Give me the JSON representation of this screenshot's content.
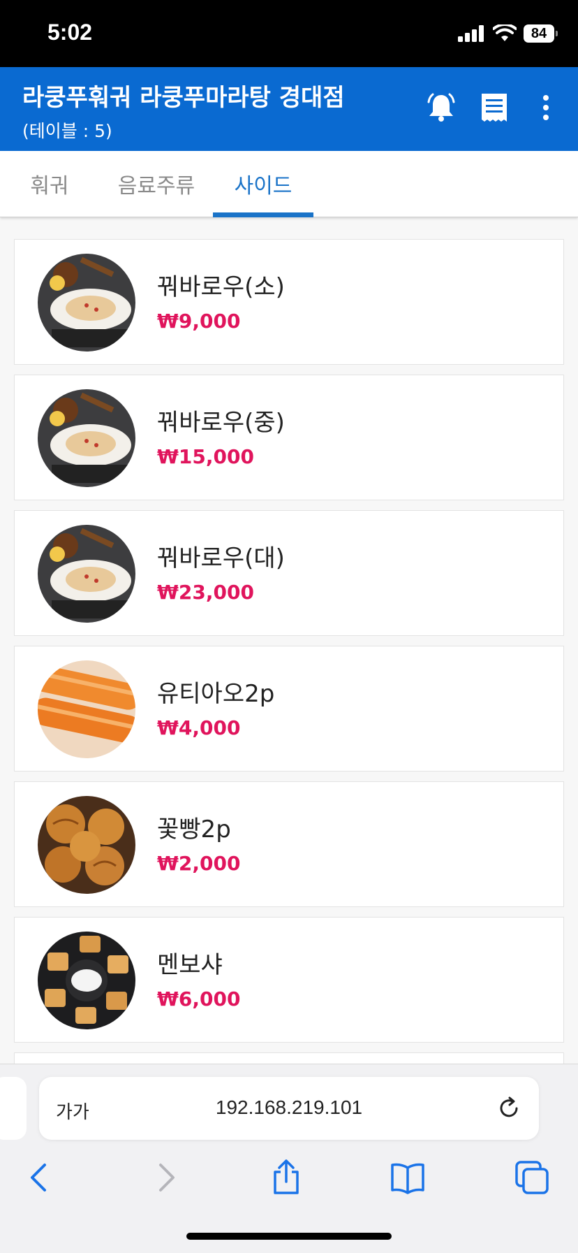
{
  "status_bar": {
    "time": "5:02",
    "battery": "84"
  },
  "header": {
    "title": "라쿵푸훠궈 라쿵푸마라탕 경대점",
    "subtitle": "(테이블 : 5)"
  },
  "tabs": [
    {
      "label": "훠궈",
      "active": false
    },
    {
      "label": "음료주류",
      "active": false
    },
    {
      "label": "사이드",
      "active": true
    }
  ],
  "menu_items": [
    {
      "name": "꿔바로우(소)",
      "price": "₩9,000",
      "image": "dumpling-plate"
    },
    {
      "name": "꿔바로우(중)",
      "price": "₩15,000",
      "image": "dumpling-plate"
    },
    {
      "name": "꿔바로우(대)",
      "price": "₩23,000",
      "image": "dumpling-plate"
    },
    {
      "name": "유티아오2p",
      "price": "₩4,000",
      "image": "fried-dough-sticks"
    },
    {
      "name": "꽃빵2p",
      "price": "₩2,000",
      "image": "flower-buns"
    },
    {
      "name": "멘보샤",
      "price": "₩6,000",
      "image": "shrimp-toast"
    }
  ],
  "browser": {
    "text_size_label": "가가",
    "url": "192.168.219.101"
  },
  "colors": {
    "header_bg": "#0a6ad1",
    "active_tab": "#1a73c8",
    "price": "#e0145c"
  }
}
